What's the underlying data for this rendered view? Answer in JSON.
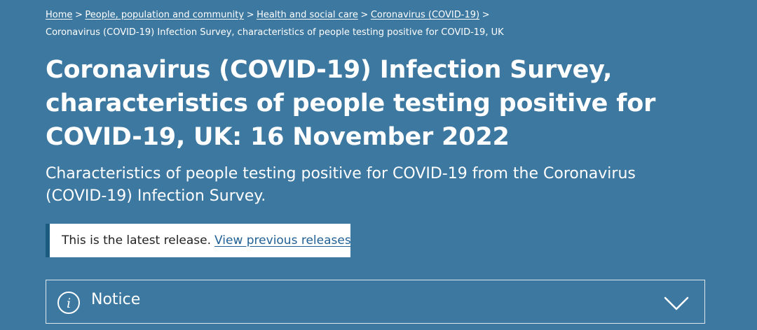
{
  "breadcrumb": {
    "items": [
      {
        "label": "Home"
      },
      {
        "label": "People, population and community"
      },
      {
        "label": "Health and social care"
      },
      {
        "label": "Coronavirus (COVID-19)"
      }
    ],
    "separator": ">",
    "current": "Coronavirus (COVID-19) Infection Survey, characteristics of people testing positive for COVID-19, UK"
  },
  "page": {
    "title": "Coronavirus (COVID-19) Infection Survey, characteristics of people testing positive for COVID-19, UK: 16 November 2022",
    "subtitle": "Characteristics of people testing positive for COVID-19 from the Coronavirus (COVID-19) Infection Survey."
  },
  "release": {
    "text": "This is the latest release.",
    "link_label": "View previous releases"
  },
  "notice": {
    "label": "Notice",
    "icon": "info-icon",
    "toggle_icon": "chevron-down-icon"
  },
  "colors": {
    "background": "#3d78a0",
    "link": "#206095",
    "release_border": "#1d5a80"
  }
}
